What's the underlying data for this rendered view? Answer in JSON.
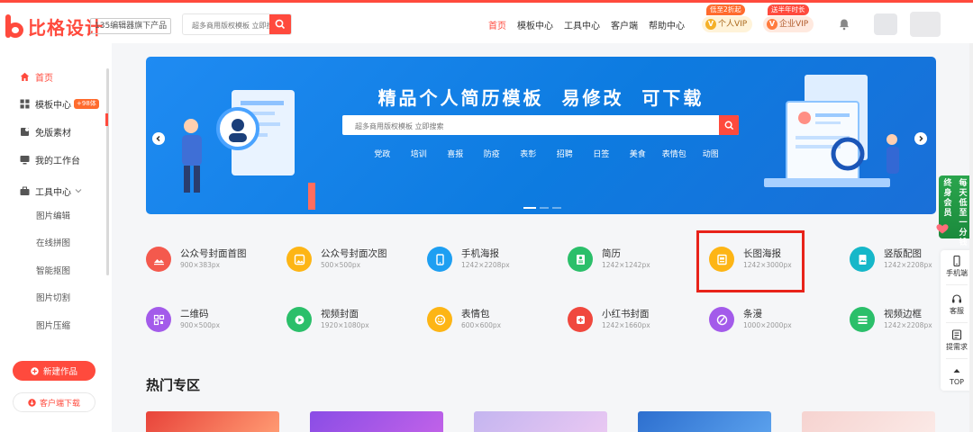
{
  "header": {
    "logo_text": "比格设计",
    "slogan": "135编辑器旗下产品",
    "search": {
      "placeholder": "超多商用版权模板 立即搜"
    },
    "nav": [
      "首页",
      "模板中心",
      "工具中心",
      "客户端",
      "帮助中心"
    ],
    "active_nav": "首页",
    "vip_personal": {
      "label": "个人VIP",
      "tag": "低至2折起"
    },
    "vip_enterprise": {
      "label": "企业VIP",
      "tag": "送半年时长"
    }
  },
  "sidebar": {
    "items": [
      {
        "label": "首页",
        "icon": "home-icon",
        "active": true
      },
      {
        "label": "模板中心",
        "icon": "grid-icon",
        "badge": "+98体"
      },
      {
        "label": "免版素材",
        "icon": "material-icon"
      },
      {
        "label": "我的工作台",
        "icon": "monitor-icon"
      },
      {
        "label": "工具中心",
        "icon": "toolbox-icon"
      }
    ],
    "tools": [
      "图片编辑",
      "在线拼图",
      "智能抠图",
      "图片切割",
      "图片压缩"
    ],
    "new_button": "新建作品",
    "download_button": "客户端下载"
  },
  "banner": {
    "title": "精品个人简历模板  易修改  可下载",
    "search_placeholder": "超多商用版权模板 立即搜索",
    "tags": [
      "党政",
      "培训",
      "喜报",
      "防疫",
      "表彰",
      "招聘",
      "日签",
      "美食",
      "表情包",
      "动图"
    ]
  },
  "categories": [
    {
      "name": "公众号封面首图",
      "size": "900×383px",
      "color": "#f4594d",
      "icon": "image-icon"
    },
    {
      "name": "公众号封面次图",
      "size": "500×500px",
      "color": "#fdb515",
      "icon": "image-icon"
    },
    {
      "name": "手机海报",
      "size": "1242×2208px",
      "color": "#1e9ff2",
      "icon": "phone-icon"
    },
    {
      "name": "简历",
      "size": "1242×1242px",
      "color": "#2bbf6a",
      "icon": "resume-icon"
    },
    {
      "name": "长图海报",
      "size": "1242×3000px",
      "color": "#fdb515",
      "icon": "long-poster-icon"
    },
    {
      "name": "竖版配图",
      "size": "1242×2208px",
      "color": "#16b7c9",
      "icon": "vertical-image-icon"
    },
    {
      "name": "二维码",
      "size": "900×500px",
      "color": "#a35bea",
      "icon": "qrcode-icon"
    },
    {
      "name": "视频封面",
      "size": "1920×1080px",
      "color": "#2bbf6a",
      "icon": "video-icon"
    },
    {
      "name": "表情包",
      "size": "600×600px",
      "color": "#fdb515",
      "icon": "emoji-icon"
    },
    {
      "name": "小红书封面",
      "size": "1242×1660px",
      "color": "#f0483e",
      "icon": "redbook-icon"
    },
    {
      "name": "条漫",
      "size": "1000×2000px",
      "color": "#a35bea",
      "icon": "comic-icon"
    },
    {
      "name": "视频边框",
      "size": "1242×2208px",
      "color": "#2bbf6a",
      "icon": "frame-icon"
    }
  ],
  "hot_section": {
    "title": "热门专区"
  },
  "float_promo": {
    "col1": "终身会员",
    "col2": "每天低至一分钱"
  },
  "float_bar": [
    "手机端",
    "客服",
    "提需求",
    "TOP"
  ],
  "colors": {
    "brand": "#ff4a3d",
    "banner": "#1a82ec",
    "highlight": "#e8231a"
  }
}
